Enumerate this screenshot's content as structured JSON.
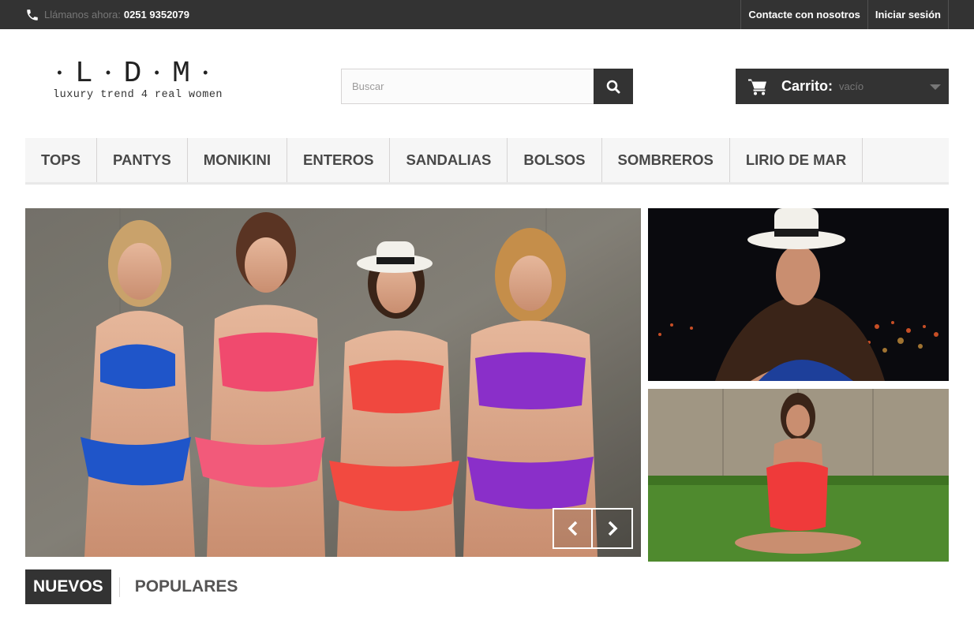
{
  "topbar": {
    "call_label": "Llámanos ahora:",
    "phone": "0251 9352079",
    "links": [
      "Contacte con nosotros",
      "Iniciar sesión"
    ]
  },
  "logo": {
    "letters": [
      "L",
      "D",
      "M"
    ],
    "tagline": "luxury trend 4 real women"
  },
  "search": {
    "placeholder": "Buscar"
  },
  "cart": {
    "title": "Carrito:",
    "status": "vacío"
  },
  "menu": {
    "items": [
      "TOPS",
      "PANTYS",
      "MONIKINI",
      "ENTEROS",
      "SANDALIAS",
      "BOLSOS",
      "SOMBREROS",
      "LIRIO DE MAR"
    ]
  },
  "tabs": {
    "active": "NUEVOS",
    "inactive": "POPULARES"
  },
  "colors": {
    "dark": "#333333",
    "menu_bg": "#f6f6f6",
    "muted": "#777777"
  },
  "icons": {
    "phone": "phone-icon",
    "search": "search-icon",
    "cart": "cart-icon",
    "prev": "chevron-left-icon",
    "next": "chevron-right-icon"
  }
}
